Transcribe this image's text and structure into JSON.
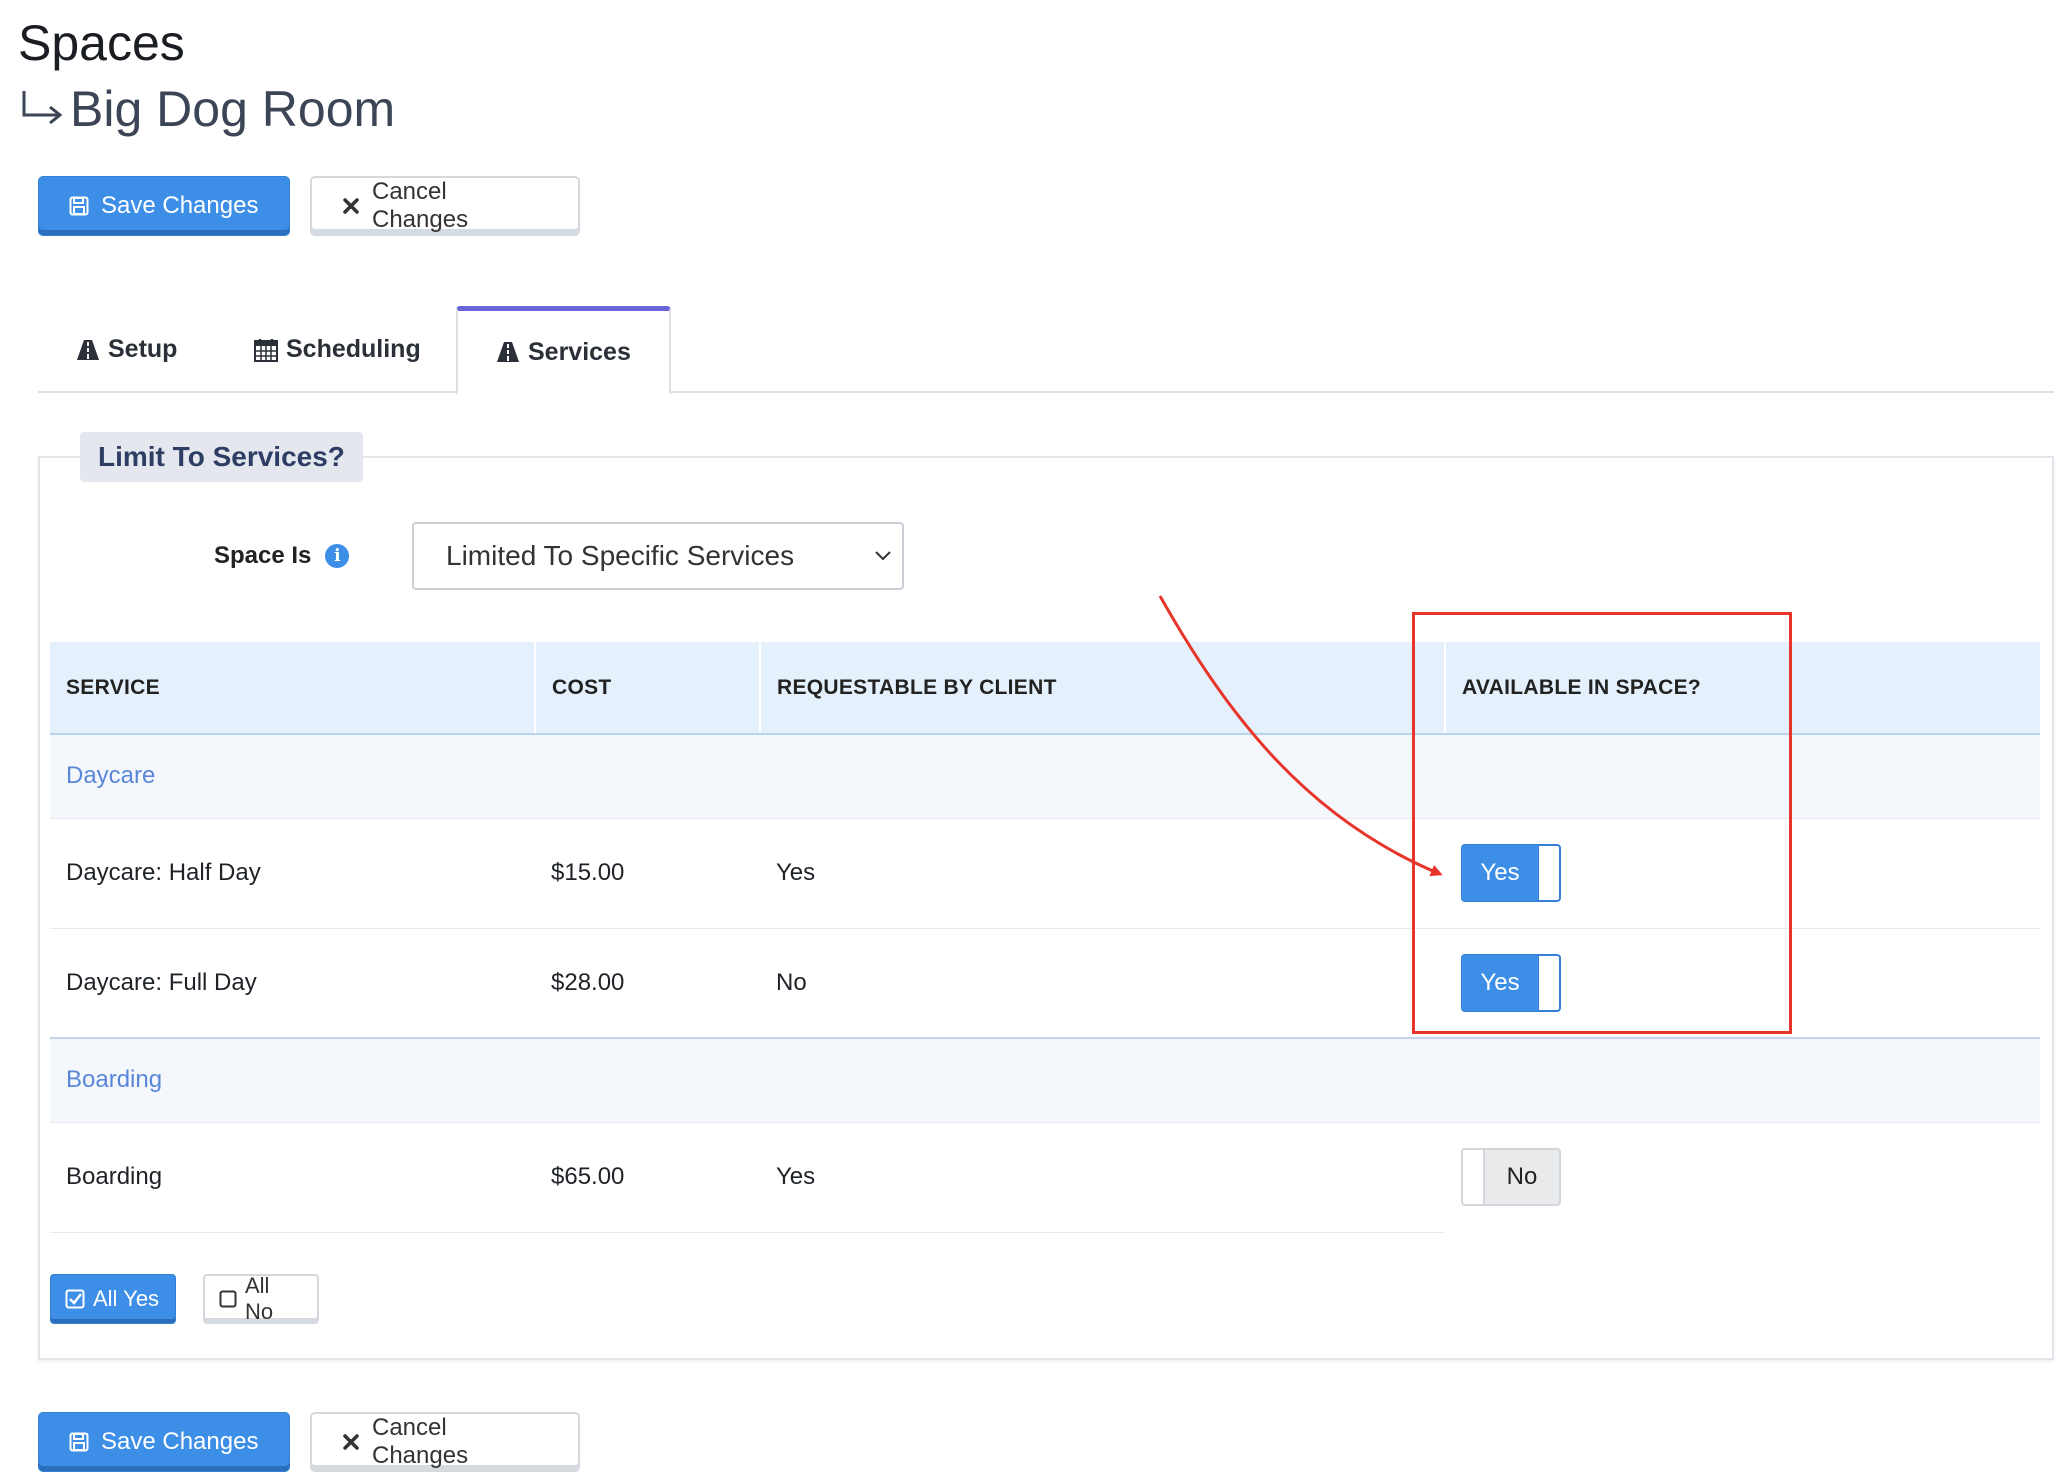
{
  "header": {
    "title": "Spaces",
    "subtitle": "Big Dog Room"
  },
  "actions": {
    "save_label": "Save Changes",
    "cancel_label": "Cancel Changes"
  },
  "tabs": [
    {
      "label": "Setup",
      "icon": "road-icon"
    },
    {
      "label": "Scheduling",
      "icon": "calendar-icon"
    },
    {
      "label": "Services",
      "icon": "road-icon",
      "active": true
    }
  ],
  "panel": {
    "legend": "Limit To Services?",
    "space_is_label": "Space Is",
    "space_is_value": "Limited To Specific Services"
  },
  "table": {
    "headers": [
      "SERVICE",
      "COST",
      "REQUESTABLE BY CLIENT",
      "AVAILABLE IN SPACE?"
    ],
    "groups": [
      {
        "name": "Daycare",
        "rows": [
          {
            "service": "Daycare: Half Day",
            "cost": "$15.00",
            "requestable": "Yes",
            "available": "Yes"
          },
          {
            "service": "Daycare: Full Day",
            "cost": "$28.00",
            "requestable": "No",
            "available": "Yes"
          }
        ]
      },
      {
        "name": "Boarding",
        "rows": [
          {
            "service": "Boarding",
            "cost": "$65.00",
            "requestable": "Yes",
            "available": "No"
          }
        ]
      }
    ]
  },
  "bulk": {
    "all_yes": "All Yes",
    "all_no": "All No"
  },
  "colors": {
    "primary": "#3d8ee6",
    "tab_accent": "#6a66d9",
    "annotation": "#e8352b",
    "group_text": "#5a86d8"
  }
}
